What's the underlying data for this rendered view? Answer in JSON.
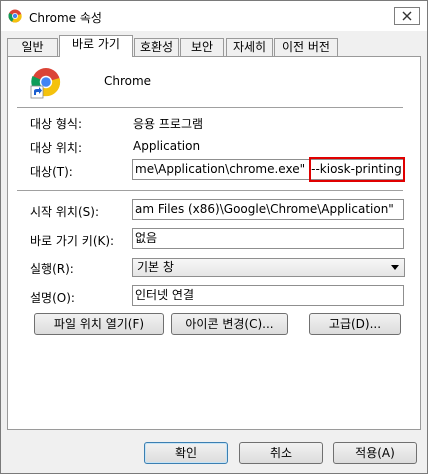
{
  "window": {
    "title": "Chrome 속성"
  },
  "tabs": [
    "일반",
    "바로 가기",
    "호환성",
    "보안",
    "자세히",
    "이전 버전"
  ],
  "shortcut": {
    "name": "Chrome",
    "target_type_label": "대상 형식:",
    "target_type_value": "응용 프로그램",
    "target_location_label": "대상 위치:",
    "target_location_value": "Application",
    "target_label": "대상(T):",
    "target_value": "me\\Application\\chrome.exe\"",
    "target_arg": "--kiosk-printing",
    "start_in_label": "시작 위치(S):",
    "start_in_value": "am Files (x86)\\Google\\Chrome\\Application\"",
    "hotkey_label": "바로 가기 키(K):",
    "hotkey_value": "없음",
    "run_label": "실행(R):",
    "run_value": "기본 창",
    "comment_label": "설명(O):",
    "comment_value": "인터넷 연결",
    "open_location_button": "파일 위치 열기(F)",
    "change_icon_button": "아이콘 변경(C)...",
    "advanced_button": "고급(D)..."
  },
  "footer": {
    "ok": "확인",
    "cancel": "취소",
    "apply": "적용(A)"
  },
  "colors": {
    "highlight": "#e00000"
  }
}
